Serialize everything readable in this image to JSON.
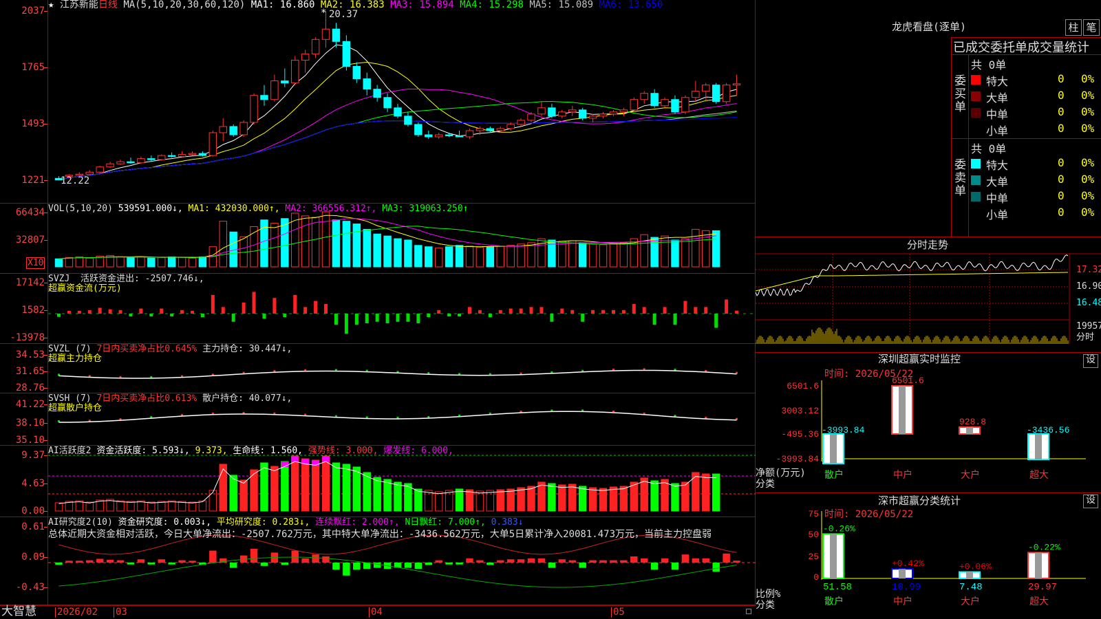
{
  "main_chart": {
    "title": "江苏新能",
    "period": "日线",
    "ma_header": "MA(5,10,20,30,60,120)",
    "ma": [
      {
        "label": "MA1: 16.860",
        "color": "#ffffff"
      },
      {
        "label": "MA2: 16.383",
        "color": "#ffff00"
      },
      {
        "label": "MA3: 15.894",
        "color": "#ff00ff"
      },
      {
        "label": "MA4: 15.298",
        "color": "#00ff00"
      },
      {
        "label": "MA5: 15.089",
        "color": "#c0c0c0"
      },
      {
        "label": "MA6: 13.650",
        "color": "#0000ff"
      }
    ],
    "price_ticks": [
      "2037",
      "1765",
      "1493",
      "1221"
    ],
    "high_label": "20.37",
    "low_label": "12.22",
    "star_glyph": "★",
    "marker_glyph": "*"
  },
  "volume": {
    "header": "VOL(5,10,20)",
    "values": [
      {
        "label": "539591.000↓,",
        "color": "#ffffff"
      },
      {
        "label": "MA1: 432030.000↑,",
        "color": "#ffff00"
      },
      {
        "label": "MA2: 366556.312↑,",
        "color": "#ff00ff"
      },
      {
        "label": "MA3: 319063.250↑",
        "color": "#00ff00"
      }
    ],
    "ticks": [
      "66434",
      "32807"
    ],
    "unit": "X10"
  },
  "svzj": {
    "header": "SVZJ",
    "line1": "活跃资金进出: -2507.746↓,",
    "line2": "超赢资金流(万元)",
    "ticks": [
      "17142",
      "1582",
      "-13978"
    ]
  },
  "svzl": {
    "header": "SVZL (7)",
    "ratio": "7日内买卖净占比0.645%",
    "hold": "主力持仓: 30.447↓,",
    "line2": "超赢主力持仓",
    "ticks": [
      "34.53",
      "31.65",
      "28.76"
    ]
  },
  "svsh": {
    "header": "SVSH (7)",
    "ratio": "7日内买卖净占比0.613%",
    "hold": "散户持仓: 40.077↓,",
    "line2": "超赢散户持仓",
    "ticks": [
      "41.22",
      "38.10",
      "35.10"
    ]
  },
  "ai_active": {
    "header": "AI活跃度2",
    "items": [
      {
        "label": "资金活跃度: 5.593↓,",
        "color": "#ffffff"
      },
      {
        "label": "9.373,",
        "color": "#ffff00"
      },
      {
        "label": "生命线: 1.560,",
        "color": "#ffffff"
      },
      {
        "label": "强势线: 3.000,",
        "color": "#ff3333"
      },
      {
        "label": "爆发线: 6.000,",
        "color": "#ff00ff"
      }
    ],
    "ticks": [
      "9.37",
      "4.63",
      "0.00"
    ]
  },
  "ai_research": {
    "header": "AI研究度2(10)",
    "items": [
      {
        "label": "资金研究度: 0.003↓,",
        "color": "#ffffff"
      },
      {
        "label": "平均研究度: 0.283↓,",
        "color": "#ffff00"
      },
      {
        "label": "连续飘红: 2.000↑,",
        "color": "#ff00ff"
      },
      {
        "label": "N日飘红: 7.000↑,",
        "color": "#00ff00"
      },
      {
        "label": "0.383↓",
        "color": "#3355ff"
      }
    ],
    "summary": "总体近期大资金相对活跃，今日大单净流出：-2507.762万元，其中特大单净流出：-3436.562万元，大单5日累计净入20081.473万元，当前主力控盘弱",
    "ticks": [
      "0.61",
      "0.09",
      "-0.43"
    ]
  },
  "bottom_axis": {
    "brand": "大智慧",
    "labels": [
      "2026/02",
      "03",
      "04",
      "05"
    ]
  },
  "dragon_tiger": {
    "title": "龙虎看盘(逐单)",
    "btn_bar": "柱",
    "btn_pen": "笔",
    "tabs_label": "已成交委托单成交量统计",
    "buy": {
      "side": "委买单",
      "total": "共 0单",
      "rows": [
        {
          "name": "特大",
          "count": "0",
          "pct": "0%",
          "color": "#ff0000"
        },
        {
          "name": "大单",
          "count": "0",
          "pct": "0%",
          "color": "#8b0000"
        },
        {
          "name": "中单",
          "count": "0",
          "pct": "0%",
          "color": "#5a0000"
        },
        {
          "name": "小单",
          "count": "0",
          "pct": "0%",
          "color": "#000000"
        }
      ]
    },
    "sell": {
      "side": "委卖单",
      "total": "共 0单",
      "rows": [
        {
          "name": "特大",
          "count": "0",
          "pct": "0%",
          "color": "#00ffff"
        },
        {
          "name": "大单",
          "count": "0",
          "pct": "0%",
          "color": "#008b8b"
        },
        {
          "name": "中单",
          "count": "0",
          "pct": "0%",
          "color": "#006a6a"
        },
        {
          "name": "小单",
          "count": "0",
          "pct": "0%",
          "color": "#000000"
        }
      ]
    }
  },
  "intraday": {
    "title": "分时走势",
    "ticks": [
      "17.32",
      "16.90",
      "16.48",
      "19957"
    ],
    "unit": "分时"
  },
  "sz_monitor": {
    "title": "深圳超赢实时监控",
    "settings": "设",
    "time": "时间: 2026/05/22",
    "ticks": [
      "6501.6",
      "3003.12",
      "-495.36",
      "-3993.84"
    ],
    "ylabel": "净额(万元)",
    "xlabel": "分类",
    "categories": [
      "散户",
      "中户",
      "大户",
      "超大"
    ],
    "bar_labels": [
      "-3993.84",
      "6501.6",
      "928.8",
      "-3436.56"
    ]
  },
  "sz_stats": {
    "title": "深市超赢分类统计",
    "settings": "设",
    "time": "时间: 2026/05/22",
    "ticks": [
      "75",
      "50",
      "25",
      "0"
    ],
    "ylabel": "比例%",
    "xlabel": "分类",
    "categories": [
      "散户",
      "中户",
      "大户",
      "超大"
    ],
    "change_labels": [
      "-0.26%",
      "+0.42%",
      "+0.06%",
      "-0.22%"
    ],
    "change_colors": [
      "#00ff00",
      "#ff0000",
      "#ff0000",
      "#00ff00"
    ],
    "pct_labels": [
      "51.58",
      "10.99",
      "7.48",
      "29.97"
    ]
  },
  "chart_data": {
    "type": "candlestick",
    "title": "江苏新能 日线",
    "ylim": [
      12.21,
      20.37
    ],
    "candles": [
      [
        12.3,
        12.4,
        12.2,
        12.22
      ],
      [
        12.4,
        12.5,
        12.3,
        12.45
      ],
      [
        12.45,
        12.6,
        12.35,
        12.5
      ],
      [
        12.5,
        12.7,
        12.45,
        12.6
      ],
      [
        12.6,
        12.9,
        12.5,
        12.85
      ],
      [
        12.85,
        13.1,
        12.8,
        13.0
      ],
      [
        13.0,
        13.2,
        12.95,
        13.1
      ],
      [
        13.1,
        13.3,
        13.0,
        13.05
      ],
      [
        13.05,
        13.35,
        13.0,
        13.25
      ],
      [
        13.25,
        13.4,
        13.1,
        13.2
      ],
      [
        13.2,
        13.45,
        13.15,
        13.4
      ],
      [
        13.4,
        13.55,
        13.3,
        13.35
      ],
      [
        13.35,
        13.6,
        13.3,
        13.45
      ],
      [
        13.45,
        13.6,
        13.4,
        13.5
      ],
      [
        13.5,
        13.6,
        13.35,
        13.4
      ],
      [
        13.4,
        14.6,
        13.35,
        14.5
      ],
      [
        14.5,
        15.2,
        14.1,
        14.8
      ],
      [
        14.8,
        14.9,
        14.3,
        14.4
      ],
      [
        14.4,
        15.1,
        14.3,
        15.0
      ],
      [
        15.0,
        16.4,
        14.9,
        16.3
      ],
      [
        16.3,
        16.8,
        15.8,
        16.1
      ],
      [
        16.1,
        17.3,
        16.0,
        17.0
      ],
      [
        17.0,
        17.6,
        16.7,
        16.9
      ],
      [
        16.9,
        18.2,
        16.8,
        18.0
      ],
      [
        18.0,
        18.5,
        17.4,
        18.3
      ],
      [
        18.3,
        19.1,
        18.1,
        19.0
      ],
      [
        19.0,
        20.37,
        18.6,
        19.5
      ],
      [
        19.5,
        19.8,
        18.6,
        18.9
      ],
      [
        18.9,
        19.2,
        17.5,
        17.7
      ],
      [
        17.7,
        17.9,
        16.9,
        17.1
      ],
      [
        17.1,
        17.4,
        16.3,
        16.6
      ],
      [
        16.6,
        16.8,
        16.0,
        16.2
      ],
      [
        16.2,
        16.4,
        15.5,
        15.7
      ],
      [
        15.7,
        15.9,
        15.2,
        15.3
      ],
      [
        15.3,
        15.5,
        14.8,
        14.9
      ],
      [
        14.9,
        15.0,
        14.3,
        14.4
      ],
      [
        14.4,
        14.6,
        14.2,
        14.3
      ],
      [
        14.3,
        14.5,
        14.2,
        14.4
      ],
      [
        14.4,
        14.5,
        14.3,
        14.35
      ],
      [
        14.35,
        14.6,
        14.3,
        14.3
      ],
      [
        14.3,
        14.7,
        14.2,
        14.6
      ],
      [
        14.6,
        14.8,
        14.4,
        14.7
      ],
      [
        14.7,
        14.8,
        14.5,
        14.6
      ],
      [
        14.6,
        14.8,
        14.5,
        14.7
      ],
      [
        14.7,
        15.0,
        14.6,
        14.9
      ],
      [
        14.9,
        15.2,
        14.8,
        15.1
      ],
      [
        15.1,
        15.5,
        15.0,
        15.4
      ],
      [
        15.4,
        16.0,
        15.3,
        15.7
      ],
      [
        15.7,
        15.9,
        15.2,
        15.3
      ],
      [
        15.3,
        15.6,
        15.2,
        15.5
      ],
      [
        15.5,
        15.8,
        15.3,
        15.6
      ],
      [
        15.6,
        15.7,
        15.1,
        15.2
      ],
      [
        15.2,
        15.4,
        15.0,
        15.3
      ],
      [
        15.3,
        15.5,
        15.2,
        15.4
      ],
      [
        15.4,
        15.6,
        15.3,
        15.5
      ],
      [
        15.5,
        15.7,
        15.3,
        15.6
      ],
      [
        15.6,
        16.2,
        15.5,
        16.1
      ],
      [
        16.1,
        16.5,
        15.9,
        16.4
      ],
      [
        16.4,
        16.6,
        15.7,
        15.8
      ],
      [
        15.8,
        16.2,
        15.7,
        16.1
      ],
      [
        16.1,
        16.3,
        15.4,
        15.5
      ],
      [
        15.5,
        16.3,
        15.4,
        16.2
      ],
      [
        16.2,
        17.0,
        16.0,
        16.5
      ],
      [
        16.5,
        16.9,
        16.0,
        16.8
      ],
      [
        16.8,
        16.9,
        15.9,
        16.0
      ],
      [
        16.0,
        16.9,
        15.9,
        16.8
      ],
      [
        16.8,
        17.3,
        16.3,
        16.86
      ]
    ],
    "volume": [
      120,
      140,
      150,
      130,
      160,
      170,
      150,
      140,
      150,
      130,
      140,
      150,
      140,
      130,
      150,
      300,
      680,
      520,
      450,
      600,
      700,
      650,
      720,
      800,
      760,
      740,
      820,
      700,
      680,
      640,
      560,
      490,
      460,
      420,
      400,
      320,
      300,
      280,
      300,
      320,
      310,
      290,
      300,
      310,
      320,
      340,
      360,
      420,
      400,
      380,
      390,
      360,
      340,
      330,
      350,
      360,
      420,
      480,
      440,
      460,
      400,
      420,
      560,
      540,
      539
    ]
  }
}
